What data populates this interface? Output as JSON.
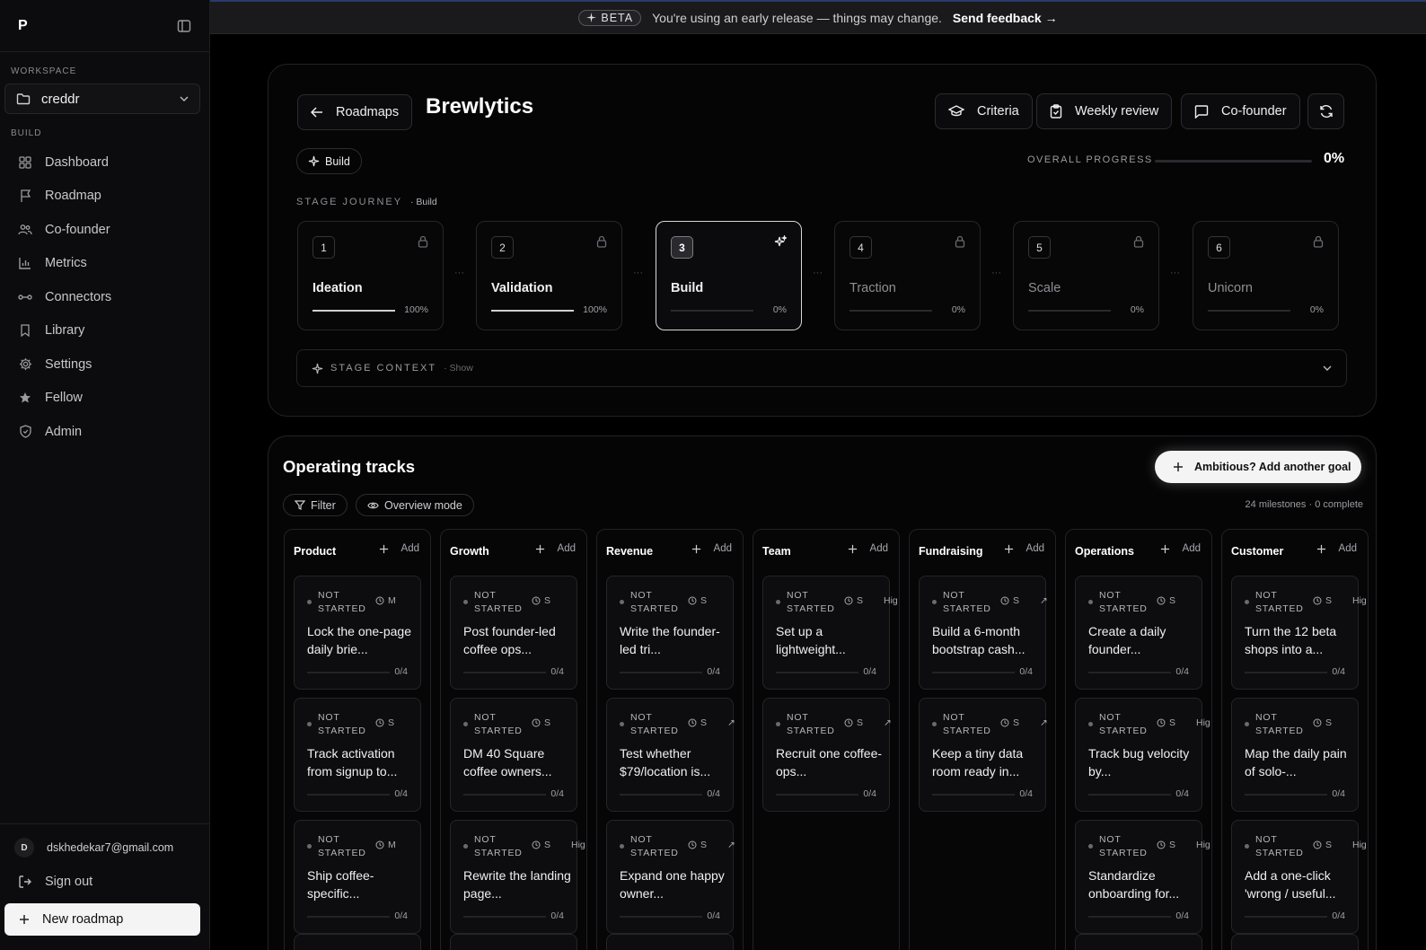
{
  "sidebar": {
    "logo": "P",
    "workspace_label": "WORKSPACE",
    "workspace": "creddr",
    "build_label": "BUILD",
    "nav": [
      {
        "label": "Dashboard",
        "icon": "grid-icon"
      },
      {
        "label": "Roadmap",
        "icon": "flag-icon"
      },
      {
        "label": "Co-founder",
        "icon": "users-icon"
      },
      {
        "label": "Metrics",
        "icon": "bar-chart-icon"
      },
      {
        "label": "Connectors",
        "icon": "connector-icon"
      },
      {
        "label": "Library",
        "icon": "bookmark-icon"
      },
      {
        "label": "Settings",
        "icon": "gear-icon"
      },
      {
        "label": "Fellow",
        "icon": "star-icon"
      },
      {
        "label": "Admin",
        "icon": "shield-icon"
      }
    ],
    "user_initial": "D",
    "user_email": "dskhedekar7@gmail.com",
    "sign_out": "Sign out",
    "new_roadmap": "New roadmap"
  },
  "banner": {
    "badge": "BETA",
    "message": "You're using an early release — things may change.",
    "link": "Send feedback →"
  },
  "header": {
    "back_label": "Roadmaps",
    "title": "Brewlytics",
    "criteria": "Criteria",
    "weekly_review": "Weekly review",
    "cofounder": "Co-founder",
    "stage_pill": "Build",
    "progress_label": "OVERALL PROGRESS",
    "progress_value": "0%",
    "progress_fraction": 0
  },
  "journey": {
    "label": "STAGE JOURNEY",
    "current": "Build",
    "stages": [
      {
        "num": "1",
        "name": "Ideation",
        "pct": "100%",
        "fill": 1.0
      },
      {
        "num": "2",
        "name": "Validation",
        "pct": "100%",
        "fill": 1.0
      },
      {
        "num": "3",
        "name": "Build",
        "pct": "0%",
        "fill": 0
      },
      {
        "num": "4",
        "name": "Traction",
        "pct": "0%",
        "fill": 0
      },
      {
        "num": "5",
        "name": "Scale",
        "pct": "0%",
        "fill": 0
      },
      {
        "num": "6",
        "name": "Unicorn",
        "pct": "0%",
        "fill": 0
      }
    ],
    "context_label": "STAGE CONTEXT",
    "context_show": "Show"
  },
  "tracks": {
    "title": "Operating tracks",
    "add_goal": "Ambitious? Add another goal",
    "filter": "Filter",
    "overview": "Overview mode",
    "count": "24 milestones · 0 complete",
    "add_label": "Add",
    "status_line1": "NOT",
    "status_line2": "STARTED",
    "columns": [
      {
        "name": "Product",
        "cards": [
          {
            "size": "M",
            "prio": "",
            "title": "Lock the one-page daily brie...",
            "count": "0/4"
          },
          {
            "size": "S",
            "prio": "",
            "title": "Track activation from signup to...",
            "count": "0/4"
          },
          {
            "size": "M",
            "prio": "",
            "title": "Ship coffee-specific...",
            "count": "0/4"
          }
        ]
      },
      {
        "name": "Growth",
        "cards": [
          {
            "size": "S",
            "prio": "",
            "title": "Post founder-led coffee ops...",
            "count": "0/4"
          },
          {
            "size": "S",
            "prio": "",
            "title": "DM 40 Square coffee owners...",
            "count": "0/4"
          },
          {
            "size": "S",
            "prio": "Hig",
            "title": "Rewrite the landing page...",
            "count": "0/4"
          }
        ]
      },
      {
        "name": "Revenue",
        "cards": [
          {
            "size": "S",
            "prio": "",
            "title": "Write the founder-led tri...",
            "count": "0/4"
          },
          {
            "size": "S",
            "prio": "↗",
            "title": "Test whether $79/location is...",
            "count": "0/4"
          },
          {
            "size": "S",
            "prio": "↗",
            "title": "Expand one happy owner...",
            "count": "0/4"
          }
        ]
      },
      {
        "name": "Team",
        "cards": [
          {
            "size": "S",
            "prio": "Hig",
            "title": "Set up a lightweight...",
            "count": "0/4"
          },
          {
            "size": "S",
            "prio": "↗",
            "title": "Recruit one coffee-ops...",
            "count": "0/4"
          }
        ]
      },
      {
        "name": "Fundraising",
        "cards": [
          {
            "size": "S",
            "prio": "↗",
            "title": "Build a 6-month bootstrap cash...",
            "count": "0/4"
          },
          {
            "size": "S",
            "prio": "↗",
            "title": "Keep a tiny data room ready in...",
            "count": "0/4"
          }
        ]
      },
      {
        "name": "Operations",
        "cards": [
          {
            "size": "S",
            "prio": "",
            "title": "Create a daily founder...",
            "count": "0/4"
          },
          {
            "size": "S",
            "prio": "Hig",
            "title": "Track bug velocity by...",
            "count": "0/4"
          },
          {
            "size": "S",
            "prio": "Hig",
            "title": "Standardize onboarding for...",
            "count": "0/4"
          }
        ]
      },
      {
        "name": "Customer",
        "cards": [
          {
            "size": "S",
            "prio": "Hig",
            "title": "Turn the 12 beta shops into a...",
            "count": "0/4"
          },
          {
            "size": "S",
            "prio": "",
            "title": "Map the daily pain of solo-...",
            "count": "0/4"
          },
          {
            "size": "S",
            "prio": "Hig",
            "title": "Add a one-click 'wrong / useful...",
            "count": "0/4"
          }
        ]
      }
    ]
  }
}
